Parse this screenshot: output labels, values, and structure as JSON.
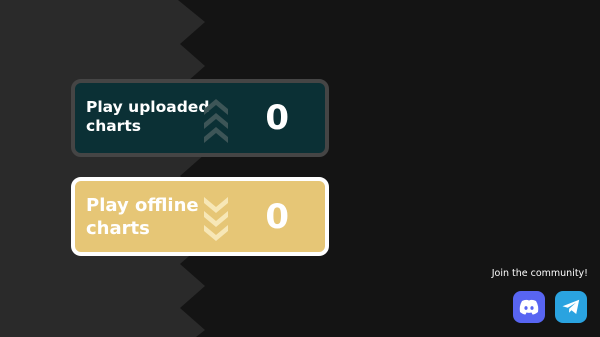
{
  "menu": {
    "uploaded": {
      "label": "Play uploaded\ncharts",
      "count": "0"
    },
    "offline": {
      "label": "Play offline\ncharts",
      "count": "0"
    }
  },
  "community": {
    "label": "Join the community!",
    "links": [
      {
        "icon": "discord-icon",
        "color": "#5865f2"
      },
      {
        "icon": "telegram-icon",
        "color": "#2aa3e0"
      }
    ]
  },
  "colors": {
    "background": "#141414",
    "zigzag_panel": "#2a2a2a",
    "uploaded_card": "#0b3035",
    "uploaded_border": "#454545",
    "offline_card": "#e6c676",
    "offline_border": "#ffffff"
  }
}
